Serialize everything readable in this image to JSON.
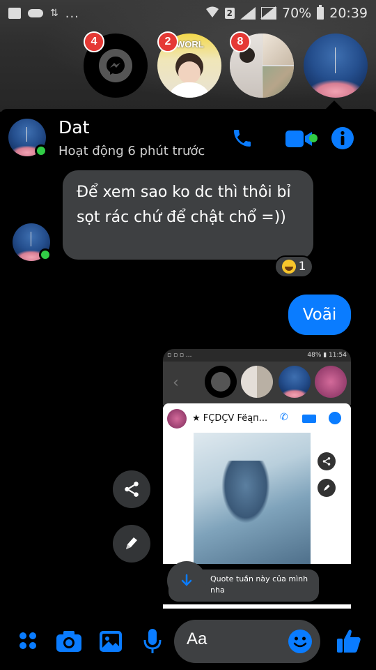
{
  "status_bar": {
    "left_dots": "...",
    "sim": "2",
    "battery": "70%",
    "time": "20:39"
  },
  "chat_heads": [
    {
      "name": "messenger",
      "badge": "4"
    },
    {
      "name": "contact-2",
      "badge": "2",
      "label": "PE WORL"
    },
    {
      "name": "group",
      "badge": "8"
    },
    {
      "name": "dat"
    }
  ],
  "header": {
    "name": "Dat",
    "presence": "Hoạt động 6 phút trước"
  },
  "messages": {
    "incoming": "Để xem sao ko dc thì thôi bỉ sọt rác chứ để chật chổ =))",
    "reaction_count": "1",
    "outgoing": "Voãi"
  },
  "shared_image": {
    "status_left": "▫ ▫ ▫ ...",
    "status_right": "48% ▮ 11:54",
    "title": "★ FÇDÇV Fëąп...",
    "quote": "Quote tuần này của mình nha"
  },
  "composer": {
    "placeholder": "Aa"
  },
  "colors": {
    "accent": "#0a7cff",
    "online": "#31cc46",
    "badge": "#e53935",
    "bubble": "#3e4042"
  }
}
